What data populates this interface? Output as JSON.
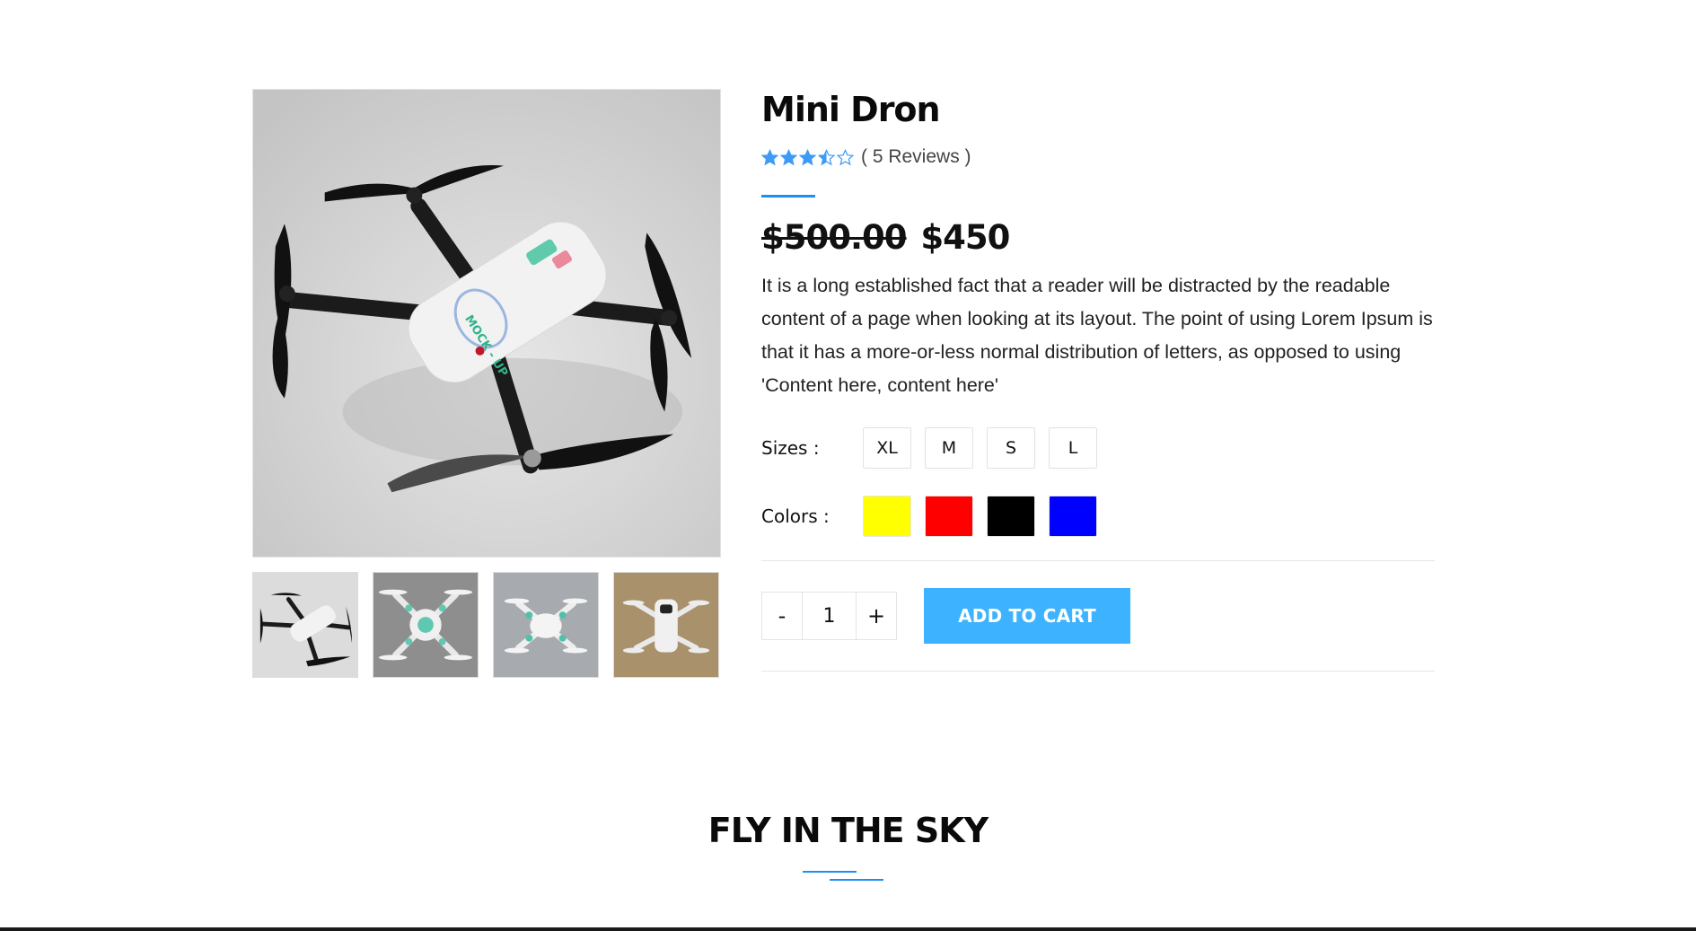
{
  "product": {
    "title": "Mini Dron",
    "rating": 3.5,
    "rating_max": 5,
    "reviews_label": "( 5 Reviews )",
    "old_price": "$500.00",
    "new_price": "$450",
    "description": "It is a long established fact that a reader will be distracted by the readable content of a page when looking at its layout. The point of using Lorem Ipsum is that it has a more-or-less normal distribution of letters, as opposed to using 'Content here, content here'",
    "sizes_label": "Sizes :",
    "sizes": [
      "XL",
      "M",
      "S",
      "L"
    ],
    "colors_label": "Colors :",
    "colors": [
      "#ffff00",
      "#ff0000",
      "#000000",
      "#0000ff"
    ],
    "quantity": "1",
    "minus_label": "-",
    "plus_label": "+",
    "add_to_cart_label": "ADD TO CART",
    "accent_color": "#1f8ef1",
    "button_color": "#3db3ff",
    "star_color": "#3e9bf5",
    "main_image_icon": "drone-photo",
    "thumbnails": [
      "drone-thumb-1",
      "drone-thumb-2",
      "drone-thumb-3",
      "drone-thumb-4"
    ]
  },
  "section": {
    "title": "FLY IN THE SKY"
  }
}
